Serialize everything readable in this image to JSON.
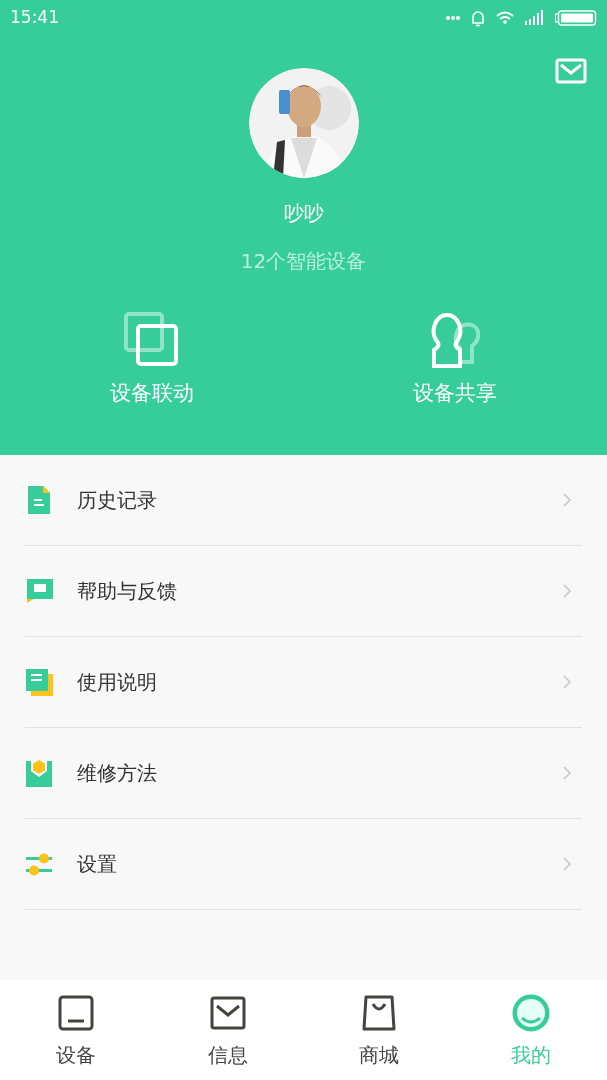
{
  "status_bar": {
    "time": "15:41"
  },
  "profile": {
    "name": "吵吵",
    "device_count": "12个智能设备"
  },
  "actions": [
    {
      "kind": "linkage",
      "label": "设备联动"
    },
    {
      "kind": "share",
      "label": "设备共享"
    }
  ],
  "menu": [
    {
      "kind": "history",
      "label": "历史记录"
    },
    {
      "kind": "feedback",
      "label": "帮助与反馈"
    },
    {
      "kind": "manual",
      "label": "使用说明"
    },
    {
      "kind": "repair",
      "label": "维修方法"
    },
    {
      "kind": "settings",
      "label": "设置"
    }
  ],
  "tabs": [
    {
      "kind": "device",
      "label": "设备",
      "selected": false
    },
    {
      "kind": "message",
      "label": "信息",
      "selected": false
    },
    {
      "kind": "shop",
      "label": "商城",
      "selected": false
    },
    {
      "kind": "me",
      "label": "我的",
      "selected": true
    }
  ]
}
